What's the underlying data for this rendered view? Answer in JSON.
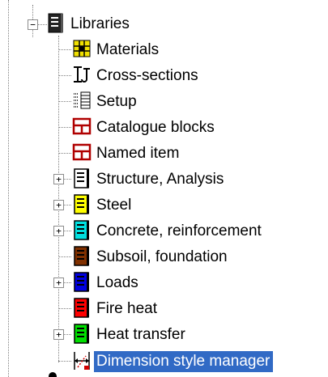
{
  "tree": {
    "root": {
      "label": "Libraries",
      "expanded": true,
      "icon": "book-black-icon"
    },
    "items": [
      {
        "label": "Materials",
        "icon": "materials-icon",
        "has_children": false,
        "selected": false
      },
      {
        "label": "Cross-sections",
        "icon": "cross-section-icon",
        "has_children": false,
        "selected": false
      },
      {
        "label": "Setup",
        "icon": "setup-list-icon",
        "has_children": false,
        "selected": false
      },
      {
        "label": "Catalogue blocks",
        "icon": "catalogue-block-icon",
        "has_children": false,
        "selected": false
      },
      {
        "label": "Named item",
        "icon": "named-item-icon",
        "has_children": false,
        "selected": false
      },
      {
        "label": "Structure, Analysis",
        "icon": "book-white-icon",
        "has_children": true,
        "selected": false
      },
      {
        "label": "Steel",
        "icon": "book-yellow-icon",
        "has_children": true,
        "selected": false
      },
      {
        "label": "Concrete, reinforcement",
        "icon": "book-cyan-icon",
        "has_children": true,
        "selected": false
      },
      {
        "label": "Subsoil, foundation",
        "icon": "book-brown-icon",
        "has_children": false,
        "selected": false
      },
      {
        "label": "Loads",
        "icon": "book-blue-icon",
        "has_children": true,
        "selected": false
      },
      {
        "label": "Fire heat",
        "icon": "book-red-icon",
        "has_children": false,
        "selected": false
      },
      {
        "label": "Heat transfer",
        "icon": "book-green-icon",
        "has_children": true,
        "selected": false
      },
      {
        "label": "Dimension style manager",
        "icon": "dimension-style-icon",
        "has_children": false,
        "selected": true
      }
    ],
    "expander_collapsed": "+",
    "expander_expanded": "−"
  },
  "colors": {
    "selection": "#316ac5",
    "guide_lines": "#808080"
  }
}
